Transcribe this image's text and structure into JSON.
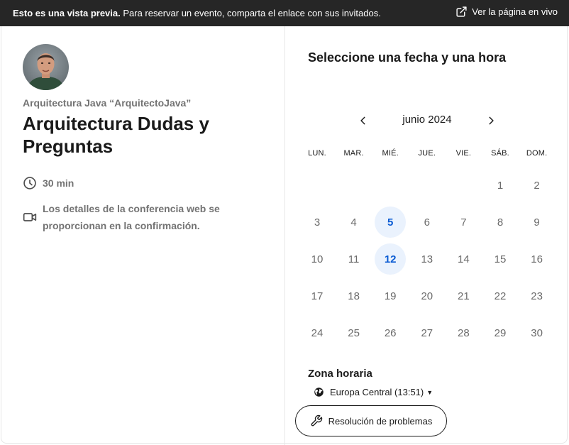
{
  "banner": {
    "preview_bold": "Esto es una vista previa.",
    "preview_text": " Para reservar un evento, comparta el enlace con sus invitados.",
    "live_link": "Ver la página en vivo"
  },
  "event": {
    "owner": "Arquitectura Java “ArquitectoJava”",
    "title": "Arquitectura Dudas y Preguntas",
    "duration": "30 min",
    "conference": "Los detalles de la conferencia web se proporcionan en la confirmación."
  },
  "calendar": {
    "heading": "Seleccione una fecha y una hora",
    "month_label": "junio 2024",
    "weekdays": [
      "LUN.",
      "MAR.",
      "MIÉ.",
      "JUE.",
      "VIE.",
      "SÁB.",
      "DOM."
    ],
    "first_weekday_index": 5,
    "days_in_month": 30,
    "available_days": [
      5,
      12
    ]
  },
  "timezone": {
    "label": "Zona horaria",
    "value": "Europa Central (13:51)"
  },
  "troubleshoot_label": "Resolución de problemas",
  "colors": {
    "banner_bg": "#262626",
    "accent": "#0a5bd3",
    "available_bg": "#eaf2fd"
  },
  "icons": [
    "external-link-icon",
    "clock-icon",
    "video-camera-icon",
    "chevron-left-icon",
    "chevron-right-icon",
    "globe-icon",
    "wrench-icon"
  ]
}
